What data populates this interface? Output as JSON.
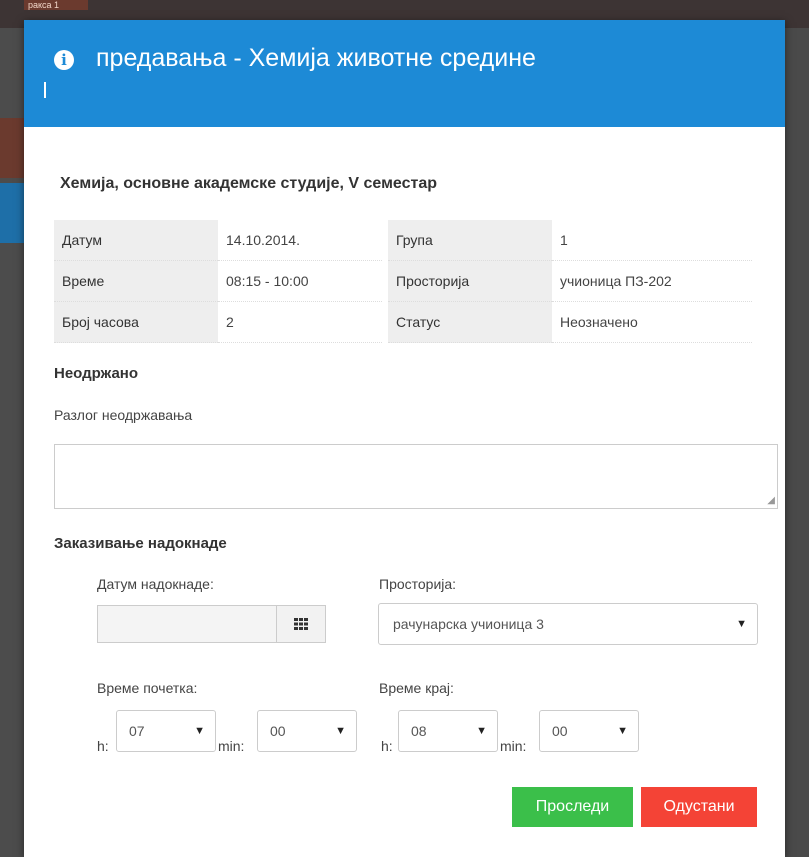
{
  "background": {
    "tab_text": "ракса 1"
  },
  "modal": {
    "title": "предавања - Хемија животне средине",
    "subtitle": "Хемија, основне академске студије, V семестар",
    "info": [
      {
        "label1": "Датум",
        "value1": "14.10.2014.",
        "label2": "Група",
        "value2": "1"
      },
      {
        "label1": "Време",
        "value1": "08:15 - 10:00",
        "label2": "Просторија",
        "value2": "учионица ПЗ-202"
      },
      {
        "label1": "Број часова",
        "value1": "2",
        "label2": "Статус",
        "value2": "Неозначено"
      }
    ],
    "not_held_heading": "Неодржано",
    "reason_label": "Разлог неодржавања",
    "reason_value": "",
    "schedule_heading": "Заказивање надокнаде",
    "date_label": "Датум надокнаде:",
    "date_value": "",
    "room_label": "Просторија:",
    "room_value": "рачунарска учионица 3",
    "start_label": "Време почетка:",
    "end_label": "Време крај:",
    "h_label": "h:",
    "min_label": "min:",
    "start_h": "07",
    "start_min": "00",
    "end_h": "08",
    "end_min": "00",
    "submit_label": "Проследи",
    "cancel_label": "Одустани"
  },
  "colors": {
    "header": "#1d8ad6",
    "submit": "#3bbf4a",
    "cancel": "#f44336"
  }
}
